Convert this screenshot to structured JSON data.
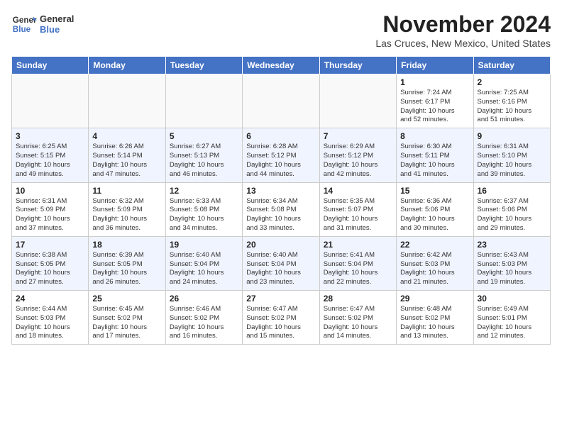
{
  "logo": {
    "line1": "General",
    "line2": "Blue"
  },
  "title": "November 2024",
  "location": "Las Cruces, New Mexico, United States",
  "days_of_week": [
    "Sunday",
    "Monday",
    "Tuesday",
    "Wednesday",
    "Thursday",
    "Friday",
    "Saturday"
  ],
  "weeks": [
    [
      {
        "day": "",
        "info": ""
      },
      {
        "day": "",
        "info": ""
      },
      {
        "day": "",
        "info": ""
      },
      {
        "day": "",
        "info": ""
      },
      {
        "day": "",
        "info": ""
      },
      {
        "day": "1",
        "info": "Sunrise: 7:24 AM\nSunset: 6:17 PM\nDaylight: 10 hours\nand 52 minutes."
      },
      {
        "day": "2",
        "info": "Sunrise: 7:25 AM\nSunset: 6:16 PM\nDaylight: 10 hours\nand 51 minutes."
      }
    ],
    [
      {
        "day": "3",
        "info": "Sunrise: 6:25 AM\nSunset: 5:15 PM\nDaylight: 10 hours\nand 49 minutes."
      },
      {
        "day": "4",
        "info": "Sunrise: 6:26 AM\nSunset: 5:14 PM\nDaylight: 10 hours\nand 47 minutes."
      },
      {
        "day": "5",
        "info": "Sunrise: 6:27 AM\nSunset: 5:13 PM\nDaylight: 10 hours\nand 46 minutes."
      },
      {
        "day": "6",
        "info": "Sunrise: 6:28 AM\nSunset: 5:12 PM\nDaylight: 10 hours\nand 44 minutes."
      },
      {
        "day": "7",
        "info": "Sunrise: 6:29 AM\nSunset: 5:12 PM\nDaylight: 10 hours\nand 42 minutes."
      },
      {
        "day": "8",
        "info": "Sunrise: 6:30 AM\nSunset: 5:11 PM\nDaylight: 10 hours\nand 41 minutes."
      },
      {
        "day": "9",
        "info": "Sunrise: 6:31 AM\nSunset: 5:10 PM\nDaylight: 10 hours\nand 39 minutes."
      }
    ],
    [
      {
        "day": "10",
        "info": "Sunrise: 6:31 AM\nSunset: 5:09 PM\nDaylight: 10 hours\nand 37 minutes."
      },
      {
        "day": "11",
        "info": "Sunrise: 6:32 AM\nSunset: 5:09 PM\nDaylight: 10 hours\nand 36 minutes."
      },
      {
        "day": "12",
        "info": "Sunrise: 6:33 AM\nSunset: 5:08 PM\nDaylight: 10 hours\nand 34 minutes."
      },
      {
        "day": "13",
        "info": "Sunrise: 6:34 AM\nSunset: 5:08 PM\nDaylight: 10 hours\nand 33 minutes."
      },
      {
        "day": "14",
        "info": "Sunrise: 6:35 AM\nSunset: 5:07 PM\nDaylight: 10 hours\nand 31 minutes."
      },
      {
        "day": "15",
        "info": "Sunrise: 6:36 AM\nSunset: 5:06 PM\nDaylight: 10 hours\nand 30 minutes."
      },
      {
        "day": "16",
        "info": "Sunrise: 6:37 AM\nSunset: 5:06 PM\nDaylight: 10 hours\nand 29 minutes."
      }
    ],
    [
      {
        "day": "17",
        "info": "Sunrise: 6:38 AM\nSunset: 5:05 PM\nDaylight: 10 hours\nand 27 minutes."
      },
      {
        "day": "18",
        "info": "Sunrise: 6:39 AM\nSunset: 5:05 PM\nDaylight: 10 hours\nand 26 minutes."
      },
      {
        "day": "19",
        "info": "Sunrise: 6:40 AM\nSunset: 5:04 PM\nDaylight: 10 hours\nand 24 minutes."
      },
      {
        "day": "20",
        "info": "Sunrise: 6:40 AM\nSunset: 5:04 PM\nDaylight: 10 hours\nand 23 minutes."
      },
      {
        "day": "21",
        "info": "Sunrise: 6:41 AM\nSunset: 5:04 PM\nDaylight: 10 hours\nand 22 minutes."
      },
      {
        "day": "22",
        "info": "Sunrise: 6:42 AM\nSunset: 5:03 PM\nDaylight: 10 hours\nand 21 minutes."
      },
      {
        "day": "23",
        "info": "Sunrise: 6:43 AM\nSunset: 5:03 PM\nDaylight: 10 hours\nand 19 minutes."
      }
    ],
    [
      {
        "day": "24",
        "info": "Sunrise: 6:44 AM\nSunset: 5:03 PM\nDaylight: 10 hours\nand 18 minutes."
      },
      {
        "day": "25",
        "info": "Sunrise: 6:45 AM\nSunset: 5:02 PM\nDaylight: 10 hours\nand 17 minutes."
      },
      {
        "day": "26",
        "info": "Sunrise: 6:46 AM\nSunset: 5:02 PM\nDaylight: 10 hours\nand 16 minutes."
      },
      {
        "day": "27",
        "info": "Sunrise: 6:47 AM\nSunset: 5:02 PM\nDaylight: 10 hours\nand 15 minutes."
      },
      {
        "day": "28",
        "info": "Sunrise: 6:47 AM\nSunset: 5:02 PM\nDaylight: 10 hours\nand 14 minutes."
      },
      {
        "day": "29",
        "info": "Sunrise: 6:48 AM\nSunset: 5:02 PM\nDaylight: 10 hours\nand 13 minutes."
      },
      {
        "day": "30",
        "info": "Sunrise: 6:49 AM\nSunset: 5:01 PM\nDaylight: 10 hours\nand 12 minutes."
      }
    ]
  ]
}
